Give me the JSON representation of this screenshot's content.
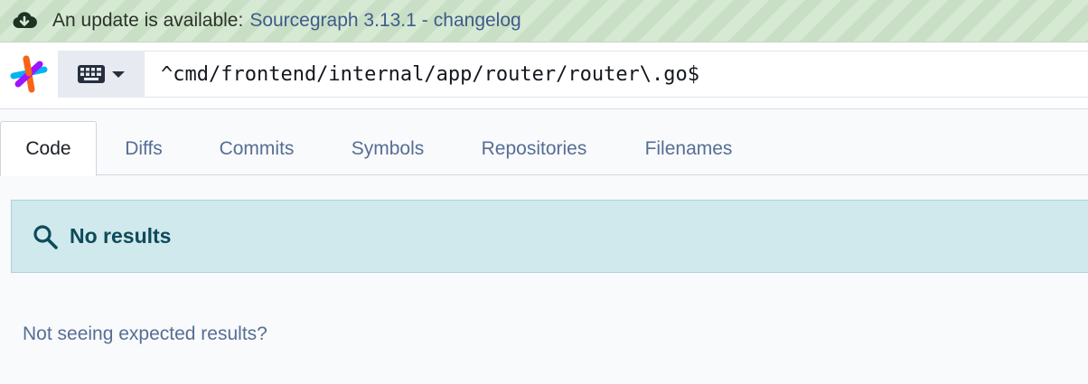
{
  "banner": {
    "message": "An update is available:",
    "version_link": "Sourcegraph 3.13.1",
    "separator": "-",
    "changelog_link": "changelog"
  },
  "search": {
    "query": "^cmd/frontend/internal/app/router/router\\.go$"
  },
  "tabs": [
    {
      "label": "Code",
      "active": true
    },
    {
      "label": "Diffs",
      "active": false
    },
    {
      "label": "Commits",
      "active": false
    },
    {
      "label": "Symbols",
      "active": false
    },
    {
      "label": "Repositories",
      "active": false
    },
    {
      "label": "Filenames",
      "active": false
    }
  ],
  "results": {
    "status": "No results",
    "hint": "Not seeing expected results?"
  },
  "icons": {
    "banner": "cloud-download-icon",
    "logo": "sourcegraph-logo",
    "keyboard": "keyboard-icon",
    "caret": "caret-down-icon",
    "alert": "search-icon"
  },
  "colors": {
    "banner_bg": "#d6e9d3",
    "link": "#3f5b8c",
    "tab_inactive": "#566e94",
    "alert_bg": "#cfe9ec",
    "alert_text": "#0f4a5a"
  }
}
